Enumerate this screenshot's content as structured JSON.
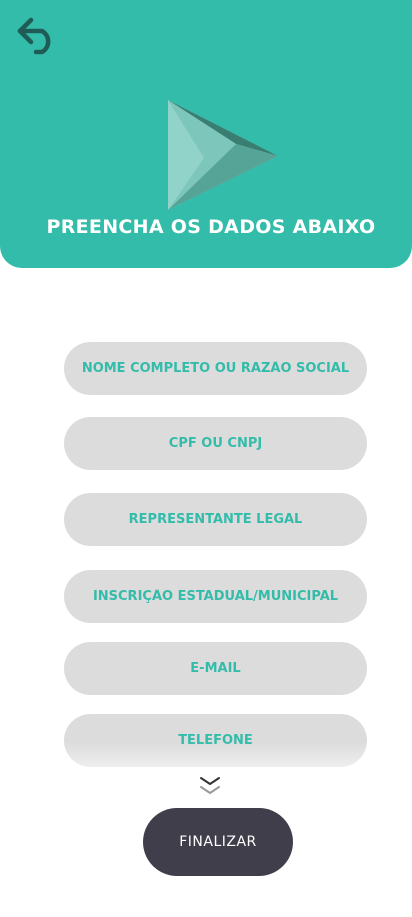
{
  "colors": {
    "primary": "#33bcaa",
    "field_bg": "#dcdcdc",
    "button_bg": "#403e4a",
    "back_icon": "#1e5c55"
  },
  "icons": {
    "back": "undo-arrow-icon",
    "logo": "play-triangle-logo",
    "scroll_hint": "double-chevron-down-icon"
  },
  "header": {
    "title": "PREENCHA OS DADOS ABAIXO"
  },
  "form": {
    "fields": [
      {
        "placeholder": "NOME COMPLETO OU RAZÃO SOCIAL",
        "value": ""
      },
      {
        "placeholder": "CPF OU CNPJ",
        "value": ""
      },
      {
        "placeholder": "REPRESENTANTE LEGAL",
        "value": ""
      },
      {
        "placeholder": "INSCRIÇÃO ESTADUAL/MUNICIPAL",
        "value": ""
      },
      {
        "placeholder": "E-MAIL",
        "value": ""
      },
      {
        "placeholder": "TELEFONE",
        "value": ""
      }
    ],
    "submit_label": "FINALIZAR"
  }
}
